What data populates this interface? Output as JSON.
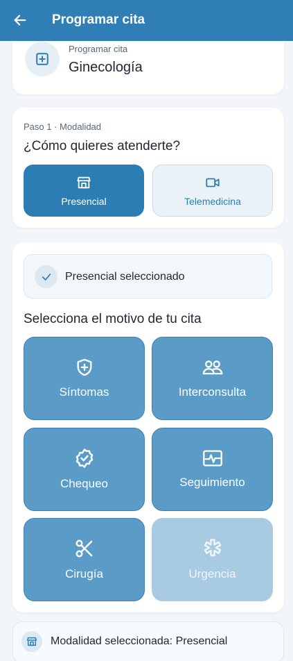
{
  "appbar": {
    "title": "Programar cita",
    "back_icon": "arrow-left-icon"
  },
  "specialty_card": {
    "label": "Programar cita",
    "specialty": "Ginecología",
    "icon": "plus-square-icon"
  },
  "modality": {
    "step": "Paso 1 · Modalidad",
    "question": "¿Cómo quieres atenderte?",
    "options": [
      {
        "label": "Presencial",
        "icon": "store-icon",
        "selected": true
      },
      {
        "label": "Telemedicina",
        "icon": "video-icon",
        "selected": false
      }
    ]
  },
  "reason": {
    "banner": "Presencial seleccionado",
    "heading": "Selecciona el motivo de tu cita",
    "tiles": [
      {
        "label": "Síntomas",
        "icon": "shield-plus-icon",
        "enabled": true
      },
      {
        "label": "Interconsulta",
        "icon": "users-icon",
        "enabled": true
      },
      {
        "label": "Chequeo",
        "icon": "badge-check-icon",
        "enabled": true
      },
      {
        "label": "Seguimiento",
        "icon": "heartbeat-icon",
        "enabled": true
      },
      {
        "label": "Cirugía",
        "icon": "scissors-icon",
        "enabled": true
      },
      {
        "label": "Urgencia",
        "icon": "asterisk-icon",
        "enabled": false
      }
    ]
  },
  "footer": {
    "text": "Modalidad seleccionada: Presencial",
    "icon": "store-icon"
  },
  "colors": {
    "primary": "#2f7fb6",
    "tile": "#5b9bc8",
    "tile_disabled": "#a9cbe1",
    "background": "#f2f5f9"
  }
}
